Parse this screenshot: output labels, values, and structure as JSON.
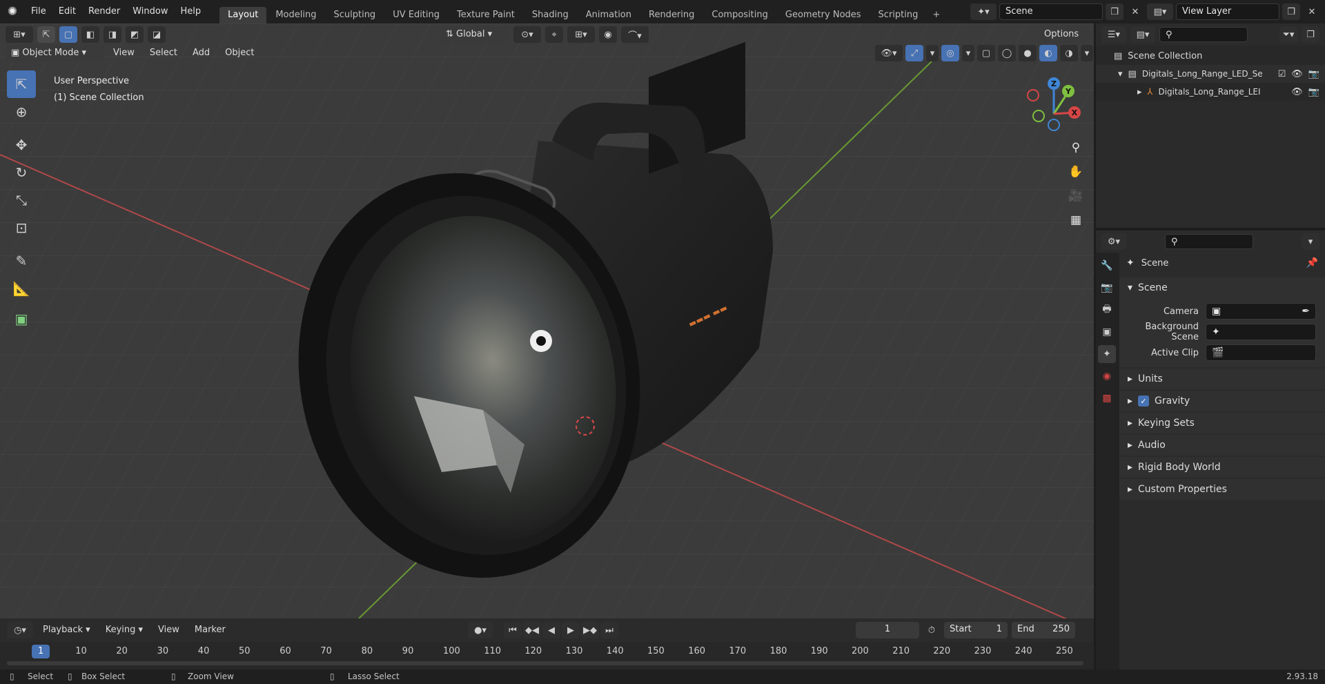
{
  "top_menu": [
    "File",
    "Edit",
    "Render",
    "Window",
    "Help"
  ],
  "workspace_tabs": [
    "Layout",
    "Modeling",
    "Sculpting",
    "UV Editing",
    "Texture Paint",
    "Shading",
    "Animation",
    "Rendering",
    "Compositing",
    "Geometry Nodes",
    "Scripting"
  ],
  "active_tab": "Layout",
  "scene_name": "Scene",
  "view_layer": "View Layer",
  "viewport": {
    "mode": "Object Mode",
    "menus": [
      "View",
      "Select",
      "Add",
      "Object"
    ],
    "transform_orientation": "Global",
    "options_label": "Options",
    "overlay_title": "User Perspective",
    "overlay_collection": "(1) Scene Collection",
    "axis_labels": {
      "x": "X",
      "y": "Y",
      "z": "Z"
    }
  },
  "outliner": {
    "root": "Scene Collection",
    "items": [
      {
        "label": "Digitals_Long_Range_LED_Se"
      },
      {
        "label": "Digitals_Long_Range_LEI"
      }
    ]
  },
  "properties": {
    "header": "Scene",
    "section": "Scene",
    "fields": [
      {
        "label": "Camera"
      },
      {
        "label": "Background Scene"
      },
      {
        "label": "Active Clip"
      }
    ],
    "panels": [
      "Units",
      "Gravity",
      "Keying Sets",
      "Audio",
      "Rigid Body World",
      "Custom Properties"
    ],
    "gravity_checked": true
  },
  "timeline": {
    "menus": [
      "Playback",
      "Keying",
      "View",
      "Marker"
    ],
    "current_frame": "1",
    "start_label": "Start",
    "start": "1",
    "end_label": "End",
    "end": "250",
    "ruler": [
      "1",
      "10",
      "20",
      "30",
      "40",
      "50",
      "60",
      "70",
      "80",
      "90",
      "100",
      "110",
      "120",
      "130",
      "140",
      "150",
      "160",
      "170",
      "180",
      "190",
      "200",
      "210",
      "220",
      "230",
      "240",
      "250"
    ]
  },
  "statusbar": {
    "select": "Select",
    "box_select": "Box Select",
    "zoom_view": "Zoom View",
    "lasso_select": "Lasso Select",
    "version": "2.93.18"
  },
  "colors": {
    "accent": "#4772b3",
    "x_axis": "#d64646",
    "y_axis": "#7fbf3f",
    "z_axis": "#3f86d6"
  }
}
